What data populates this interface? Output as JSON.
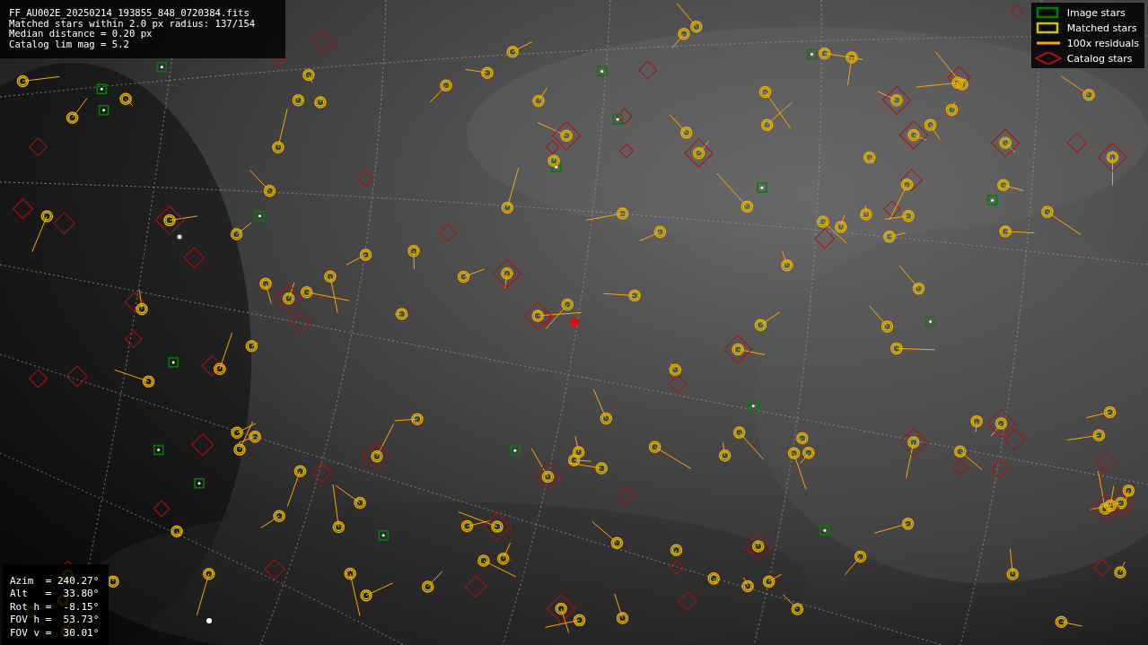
{
  "info": {
    "lines": [
      "FF_AU002E_20250214_193855_848_0720384.fits",
      "Matched stars within 2.0 px radius: 137/154",
      "Median distance = 0.20 px",
      "Catalog lim mag = 5.2"
    ]
  },
  "legend": {
    "items": [
      {
        "kind": "box",
        "label": "Image stars",
        "color": "#008000"
      },
      {
        "kind": "box",
        "label": "Matched stars",
        "color": "#c8c800"
      },
      {
        "kind": "line",
        "label": "100x residuals",
        "color": "#ffa500"
      },
      {
        "kind": "diamond",
        "label": "Catalog stars",
        "color": "#b01010"
      }
    ]
  },
  "pointing": {
    "lines": [
      "Azim  = 240.27°",
      "Alt   =  33.80°",
      "Rot h =  -8.15°",
      "FOV h =  53.73°",
      "FOV v =  30.01°"
    ]
  }
}
